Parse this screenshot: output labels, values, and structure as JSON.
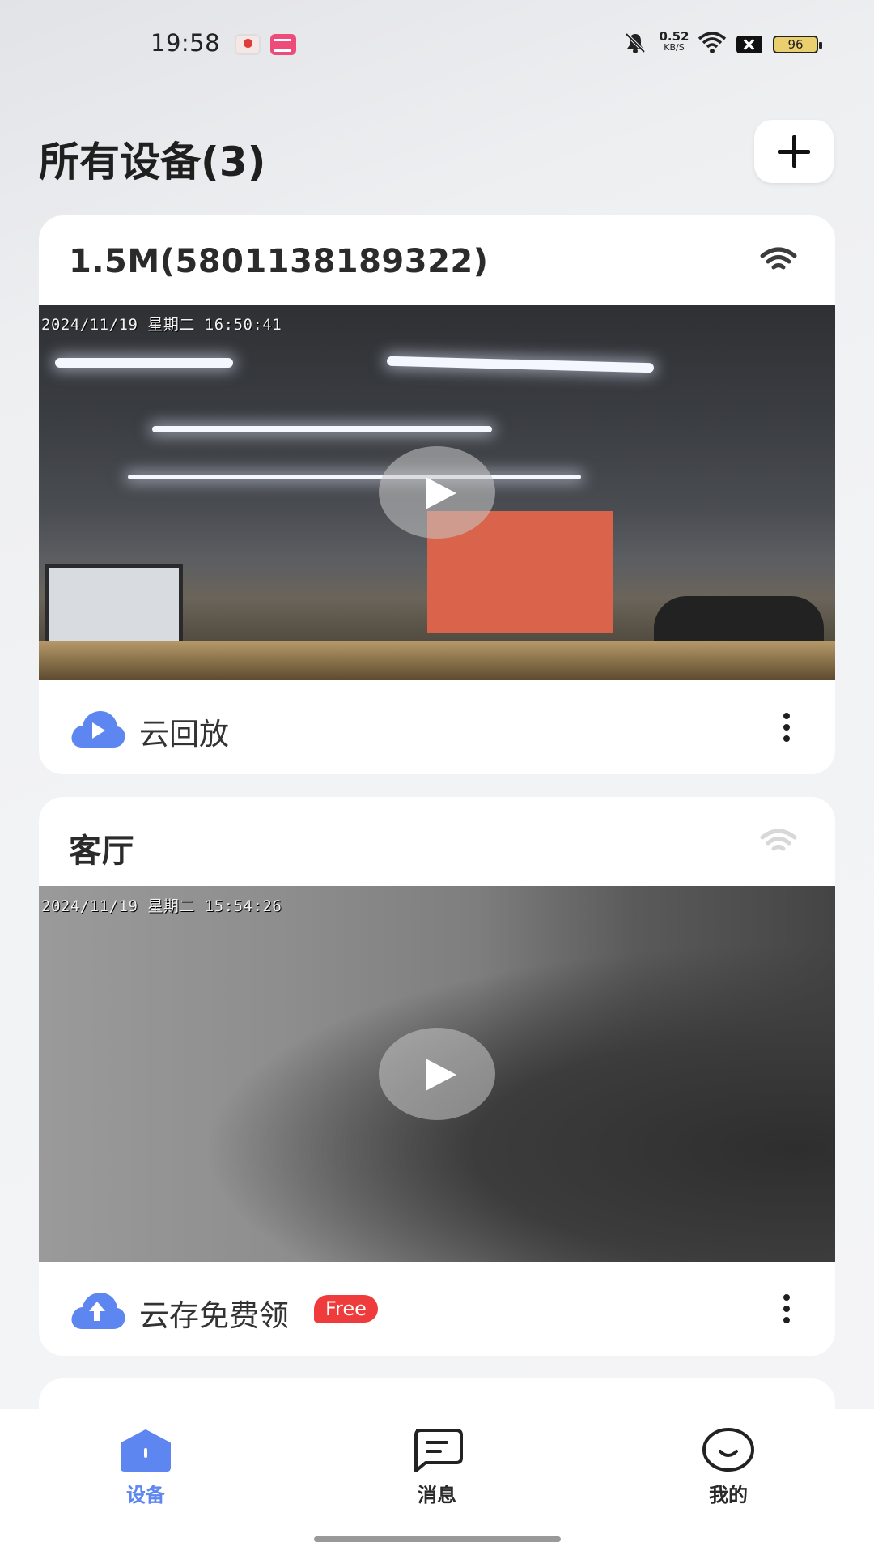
{
  "status_bar": {
    "time": "19:58",
    "speed_value": "0.52",
    "speed_unit": "KB/S",
    "battery": "96",
    "icons": [
      "app-icon-red",
      "app-icon-pink",
      "mute-bell-icon",
      "wifi-icon",
      "x-box-icon",
      "battery-icon"
    ]
  },
  "header": {
    "title": "所有设备(3)",
    "add_icon": "plus-icon"
  },
  "devices": [
    {
      "name": "1.5M(5801138189322)",
      "wifi_state": "online",
      "osd": "2024/11/19 星期二 16:50:41",
      "footer_label": "云回放",
      "footer_icon": "cloud-play-icon"
    },
    {
      "name": "客厅",
      "wifi_state": "offline",
      "osd": "2024/11/19 星期二 15:54:26",
      "footer_label": "云存免费领",
      "footer_badge": "Free",
      "footer_icon": "cloud-upload-icon"
    }
  ],
  "bottom_nav": {
    "items": [
      {
        "label": "设备",
        "icon": "home-icon",
        "active": true
      },
      {
        "label": "消息",
        "icon": "message-icon",
        "active": false
      },
      {
        "label": "我的",
        "icon": "smile-icon",
        "active": false
      }
    ]
  },
  "colors": {
    "accent": "#5d86f0",
    "badge": "#ef3b3b",
    "background": "#f2f3f5"
  }
}
